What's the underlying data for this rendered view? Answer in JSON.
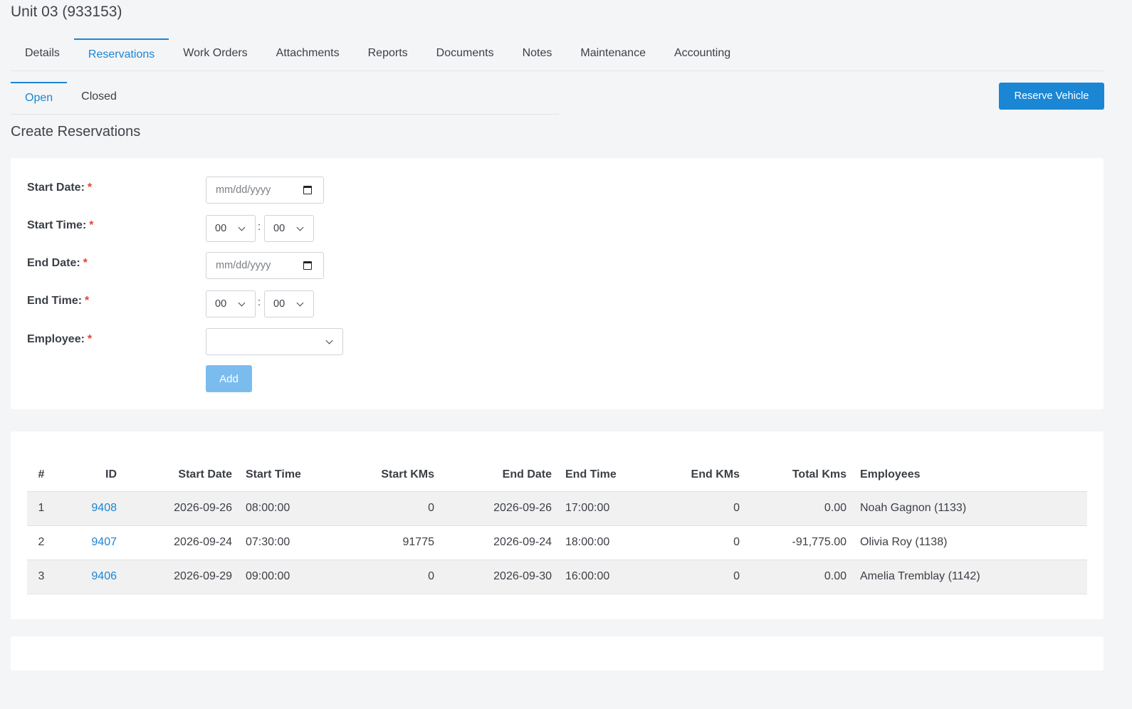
{
  "page": {
    "title": "Unit 03 (933153)"
  },
  "tabs": [
    {
      "label": "Details",
      "active": false
    },
    {
      "label": "Reservations",
      "active": true
    },
    {
      "label": "Work Orders",
      "active": false
    },
    {
      "label": "Attachments",
      "active": false
    },
    {
      "label": "Reports",
      "active": false
    },
    {
      "label": "Documents",
      "active": false
    },
    {
      "label": "Notes",
      "active": false
    },
    {
      "label": "Maintenance",
      "active": false
    },
    {
      "label": "Accounting",
      "active": false
    }
  ],
  "subtabs": [
    {
      "label": "Open",
      "active": true
    },
    {
      "label": "Closed",
      "active": false
    }
  ],
  "reserve_button": "Reserve Vehicle",
  "section_title": "Create Reservations",
  "form": {
    "required_mark": "*",
    "start_date_label": "Start Date:",
    "start_date_placeholder": "mm/dd/yyyy",
    "start_time_label": "Start Time:",
    "start_hour": "00",
    "start_minute": "00",
    "time_separator": ":",
    "end_date_label": "End Date:",
    "end_date_placeholder": "mm/dd/yyyy",
    "end_time_label": "End Time:",
    "end_hour": "00",
    "end_minute": "00",
    "employee_label": "Employee:",
    "employee_value": "",
    "add_button": "Add"
  },
  "table": {
    "headers": {
      "num": "#",
      "id": "ID",
      "start_date": "Start Date",
      "start_time": "Start Time",
      "start_kms": "Start KMs",
      "end_date": "End Date",
      "end_time": "End Time",
      "end_kms": "End KMs",
      "total_kms": "Total Kms",
      "employees": "Employees"
    },
    "rows": [
      {
        "num": "1",
        "id": "9408",
        "start_date": "2026-09-26",
        "start_time": "08:00:00",
        "start_kms": "0",
        "end_date": "2026-09-26",
        "end_time": "17:00:00",
        "end_kms": "0",
        "total_kms": "0.00",
        "employees": "Noah Gagnon (1133)"
      },
      {
        "num": "2",
        "id": "9407",
        "start_date": "2026-09-24",
        "start_time": "07:30:00",
        "start_kms": "91775",
        "end_date": "2026-09-24",
        "end_time": "18:00:00",
        "end_kms": "0",
        "total_kms": "-91,775.00",
        "employees": "Olivia Roy (1138)"
      },
      {
        "num": "3",
        "id": "9406",
        "start_date": "2026-09-29",
        "start_time": "09:00:00",
        "start_kms": "0",
        "end_date": "2026-09-30",
        "end_time": "16:00:00",
        "end_kms": "0",
        "total_kms": "0.00",
        "employees": "Amelia Tremblay (1142)"
      }
    ]
  },
  "colors": {
    "accent": "#1a86d4",
    "add_button": "#7bbcef",
    "required": "#e0443a"
  }
}
